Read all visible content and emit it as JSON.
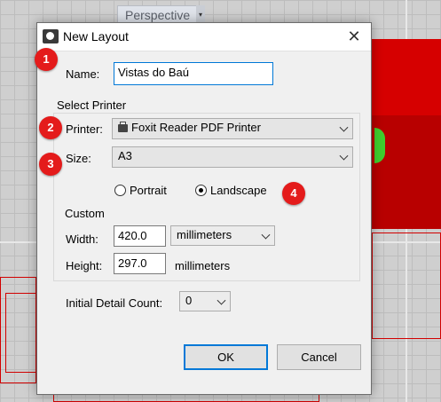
{
  "background": {
    "viewport_tab": "Perspective",
    "accent_color": "#d60000"
  },
  "dialog": {
    "title": "New Layout",
    "name_label": "Name:",
    "name_value": "Vistas do Baú",
    "select_printer_label": "Select Printer",
    "printer_label": "Printer:",
    "printer_value": "Foxit Reader PDF Printer",
    "size_label": "Size:",
    "size_value": "A3",
    "orientation": {
      "portrait_label": "Portrait",
      "landscape_label": "Landscape",
      "selected": "Landscape"
    },
    "custom_label": "Custom",
    "width_label": "Width:",
    "width_value": "420.0",
    "width_unit": "millimeters",
    "height_label": "Height:",
    "height_value": "297.0",
    "height_unit": "millimeters",
    "detail_count_label": "Initial Detail Count:",
    "detail_count_value": "0",
    "ok_label": "OK",
    "cancel_label": "Cancel"
  },
  "annotations": [
    "1",
    "2",
    "3",
    "4"
  ]
}
